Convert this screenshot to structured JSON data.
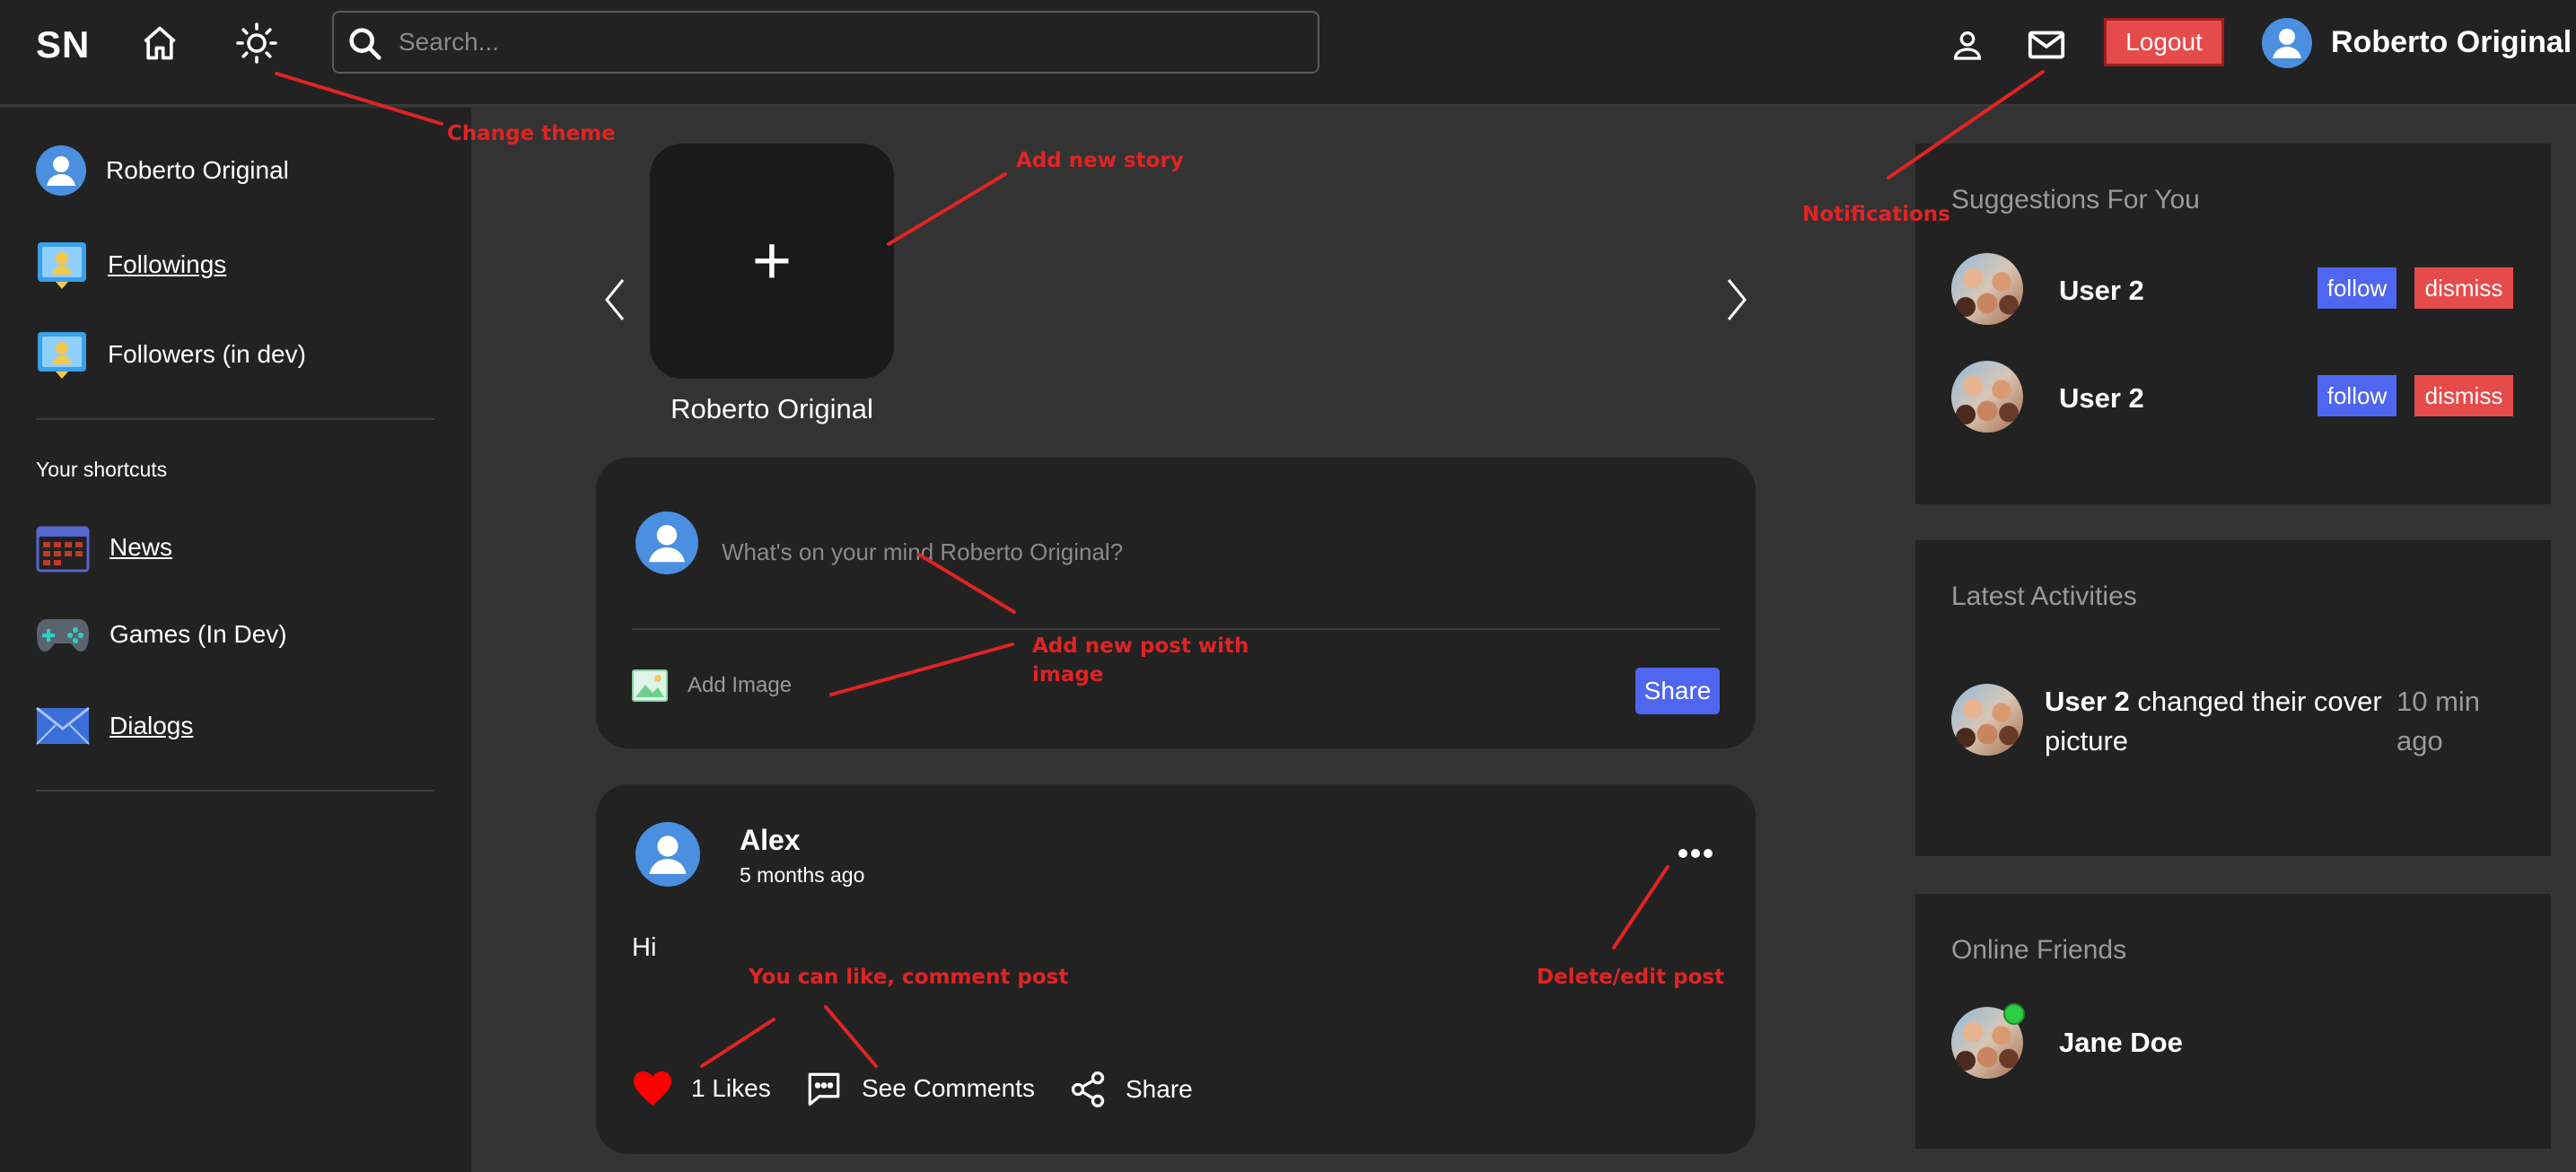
{
  "header": {
    "logo": "SN",
    "search_placeholder": "Search...",
    "logout_label": "Logout",
    "user_name": "Roberto Original"
  },
  "sidebar": {
    "profile_name": "Roberto Original",
    "items": [
      {
        "label": "Followings",
        "icon": "followings-icon"
      },
      {
        "label": "Followers (in dev)",
        "icon": "followers-icon"
      }
    ],
    "shortcuts_title": "Your shortcuts",
    "shortcuts": [
      {
        "label": "News",
        "icon": "calendar-icon"
      },
      {
        "label": "Games (In Dev)",
        "icon": "gamepad-icon"
      },
      {
        "label": "Dialogs",
        "icon": "envelope-icon"
      }
    ]
  },
  "stories": {
    "add_symbol": "+",
    "owner_name": "Roberto Original"
  },
  "create_post": {
    "placeholder": "What's on your mind Roberto Original?",
    "add_image_label": "Add Image",
    "share_label": "Share"
  },
  "post": {
    "author": "Alex",
    "time": "5 months ago",
    "text": "Hi",
    "likes_label": "1 Likes",
    "comments_label": "See Comments",
    "share_label": "Share"
  },
  "suggestions": {
    "title": "Suggestions For You",
    "items": [
      {
        "name": "User 2",
        "follow_label": "follow",
        "dismiss_label": "dismiss"
      },
      {
        "name": "User 2",
        "follow_label": "follow",
        "dismiss_label": "dismiss"
      }
    ]
  },
  "activities": {
    "title": "Latest Activities",
    "items": [
      {
        "user": "User 2",
        "action": " changed their cover picture",
        "time": "10 min ago"
      }
    ]
  },
  "online_friends": {
    "title": "Online Friends",
    "items": [
      {
        "name": "Jane Doe",
        "status": "online"
      }
    ]
  },
  "annotations": {
    "change_theme": "Change theme",
    "add_story": "Add new story",
    "notifications": "Notifications",
    "add_post": "Add new post with image",
    "like_comment": "You can like, comment post",
    "delete_edit": "Delete/edit post"
  },
  "colors": {
    "background": "#333333",
    "panel": "#222222",
    "accent_blue": "#4f66f0",
    "danger_red": "#e64b4b",
    "annotation_red": "#e02424",
    "online_green": "#2ecc40"
  }
}
